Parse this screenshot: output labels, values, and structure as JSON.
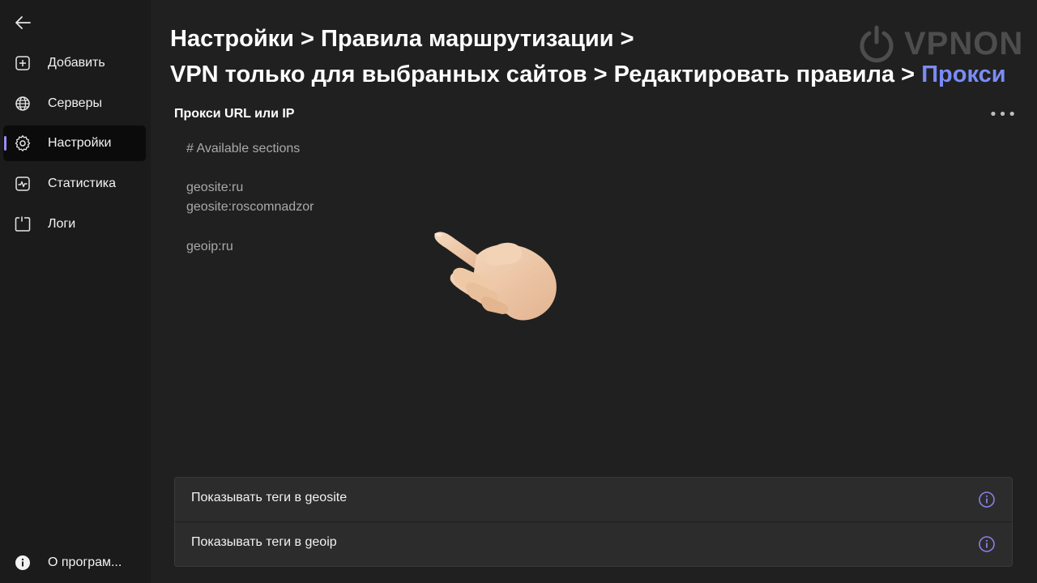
{
  "sidebar": {
    "items": [
      {
        "label": "Добавить",
        "icon": "add-icon"
      },
      {
        "label": "Серверы",
        "icon": "globe-icon"
      },
      {
        "label": "Настройки",
        "icon": "gear-icon",
        "active": true
      },
      {
        "label": "Статистика",
        "icon": "chart-icon"
      },
      {
        "label": "Логи",
        "icon": "logs-icon"
      }
    ],
    "footer": {
      "label": "О програм...",
      "icon": "info-icon"
    }
  },
  "header": {
    "breadcrumb": {
      "line1": "Настройки > Правила маршрутизации >",
      "line2": "VPN только для выбранных сайтов > Редактировать правила > ",
      "current": "Прокси"
    },
    "logo": {
      "text": "VPNON",
      "icon": "power-icon"
    }
  },
  "editor": {
    "label": "Прокси URL или IP",
    "lines": [
      "# Available sections",
      "geosite:ru",
      "geosite:roscomnadzor",
      "geoip:ru"
    ]
  },
  "options": [
    {
      "label": "Показывать теги в geosite",
      "icon": "info-icon"
    },
    {
      "label": "Показывать теги в geoip",
      "icon": "info-icon"
    }
  ],
  "colors": {
    "accent": "#7a8cf5",
    "active_indicator": "#9b8cf2",
    "info_icon": "#8b7fe6"
  }
}
